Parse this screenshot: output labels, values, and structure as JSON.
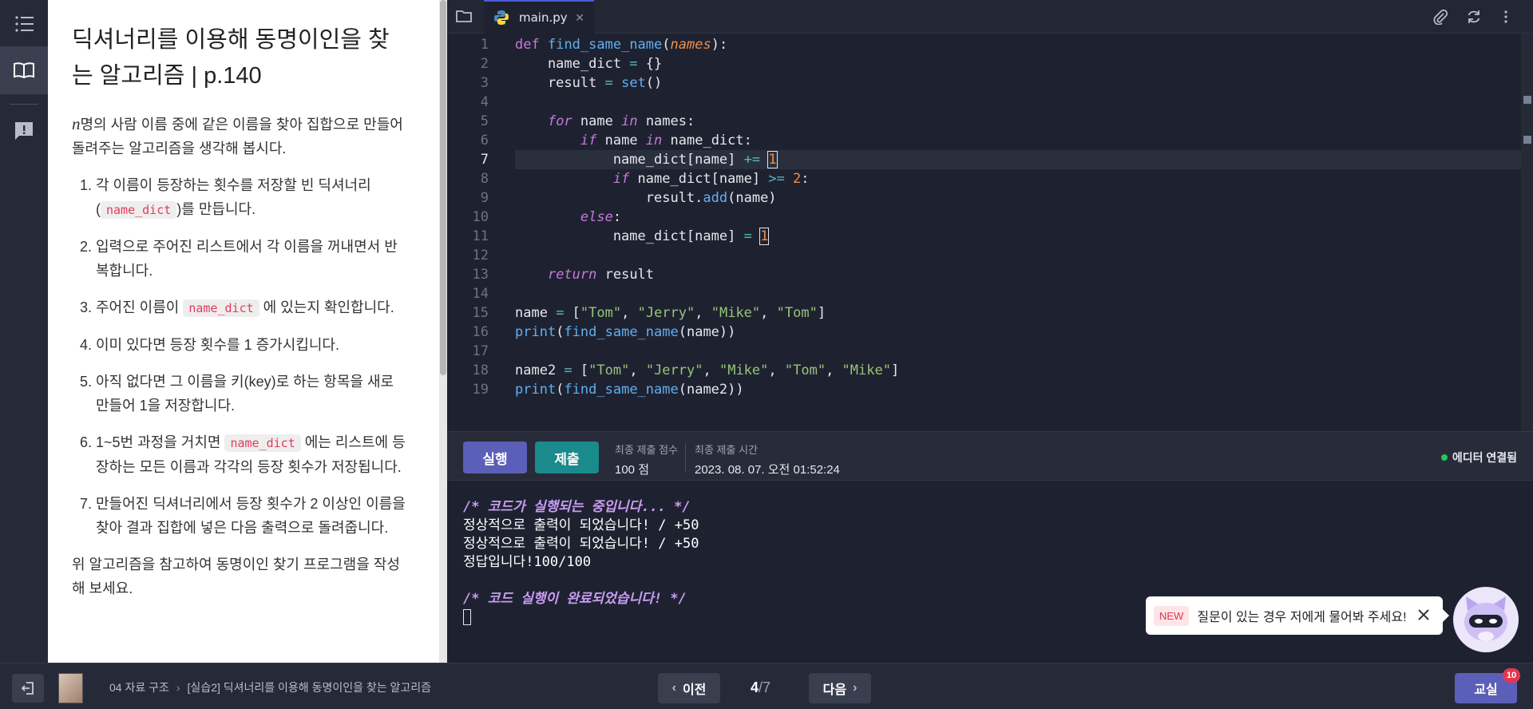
{
  "rail": {
    "tooltip": "목록"
  },
  "lesson": {
    "title": "딕셔너리를 이용해 동명이인을 찾는 알고리즘 | p.140",
    "intro_var": "n",
    "intro": "명의 사람 이름 중에 같은 이름을 찾아 집합으로 만들어 돌려주는 알고리즘을 생각해 봅시다.",
    "steps": [
      {
        "pre": "각 이름이 등장하는 횟수를 저장할 빈 딕셔너리 (",
        "code": "name_dict",
        "post": ")를 만듭니다."
      },
      {
        "pre": "입력으로 주어진 리스트에서 각 이름을 꺼내면서 반복합니다.",
        "code": "",
        "post": ""
      },
      {
        "pre": "주어진 이름이 ",
        "code": "name_dict",
        "post": " 에 있는지 확인합니다."
      },
      {
        "pre": "이미 있다면 등장 횟수를 1 증가시킵니다.",
        "code": "",
        "post": ""
      },
      {
        "pre": "아직 없다면 그 이름을 키(key)로 하는 항목을 새로 만들어 1을 저장합니다.",
        "code": "",
        "post": ""
      },
      {
        "pre": "1~5번 과정을 거치면 ",
        "code": "name_dict",
        "post": " 에는 리스트에 등장하는 모든 이름과 각각의 등장 횟수가 저장됩니다."
      },
      {
        "pre": "만들어진 딕셔너리에서 등장 횟수가 2 이상인 이름을 찾아 결과 집합에 넣은 다음 출력으로 돌려줍니다.",
        "code": "",
        "post": ""
      }
    ],
    "outro": "위 알고리즘을 참고하여 동명이인 찾기 프로그램을 작성해 보세요."
  },
  "editor": {
    "filename": "main.py",
    "lines": [
      "def find_same_name(names):",
      "    name_dict = {}",
      "    result = set()",
      "",
      "    for name in names:",
      "        if name in name_dict:",
      "            name_dict[name] += 1",
      "            if name_dict[name] >= 2:",
      "                result.add(name)",
      "        else:",
      "            name_dict[name] = 1",
      "",
      "    return result",
      "",
      "name = [\"Tom\", \"Jerry\", \"Mike\", \"Tom\"]",
      "print(find_same_name(name))",
      "",
      "name2 = [\"Tom\", \"Jerry\", \"Mike\", \"Tom\", \"Mike\"]",
      "print(find_same_name(name2))"
    ],
    "current_line": 7
  },
  "runbar": {
    "run_label": "실행",
    "submit_label": "제출",
    "score_label": "최종 제출 점수",
    "score_value": "100 점",
    "time_label": "최종 제출 시간",
    "time_value": "2023. 08. 07. 오전 01:52:24",
    "status": "에디터 연결됨"
  },
  "console": {
    "lines": [
      "/* 코드가 실행되는 중입니다... */",
      "정상적으로 출력이 되었습니다! / +50",
      "정상적으로 출력이 되었습니다! / +50",
      "정답입니다!100/100",
      "",
      "/* 코드 실행이 완료되었습니다! */"
    ]
  },
  "chat": {
    "badge": "NEW",
    "text": "질문이 있는 경우 저에게 물어봐 주세요!"
  },
  "bottom": {
    "crumb_section": "04 자료 구조",
    "crumb_page": "[실습2] 딕셔너리를 이용해 동명이인을 찾는 알고리즘",
    "prev": "이전",
    "next": "다음",
    "page_current": "4",
    "page_total": "/7",
    "classroom": "교실",
    "classroom_count": "10"
  }
}
